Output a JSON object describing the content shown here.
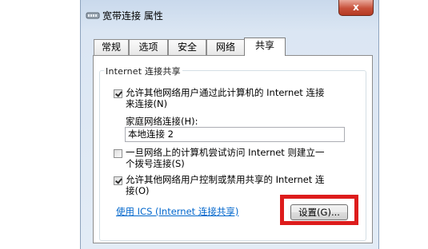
{
  "window": {
    "title": "宽带连接 属性",
    "close_label": "x"
  },
  "tabs": [
    {
      "label": "常规",
      "active": false
    },
    {
      "label": "选项",
      "active": false
    },
    {
      "label": "安全",
      "active": false
    },
    {
      "label": "网络",
      "active": false
    },
    {
      "label": "共享",
      "active": true
    }
  ],
  "sharing": {
    "group_title": "Internet 连接共享",
    "allow_share": {
      "checked": true,
      "line1": "允许其他网络用户通过此计算机的 Internet 连接",
      "line2": "来连接(N)"
    },
    "home_network_label": "家庭网络连接(H):",
    "home_network_value": "本地连接 2",
    "dial_on_demand": {
      "checked": false,
      "line1": "一旦网络上的计算机尝试访问 Internet 则建立一",
      "line2": "个拨号连接(S)"
    },
    "allow_control": {
      "checked": true,
      "line1": "允许其他网络用户控制或禁用共享的 Internet 连",
      "line2": "接(O)"
    },
    "ics_link": "使用 ICS (Internet 连接共享)",
    "settings_button": "设置(G)..."
  },
  "colors": {
    "highlight_box": "#dd1c1c",
    "link": "#0066cc"
  }
}
